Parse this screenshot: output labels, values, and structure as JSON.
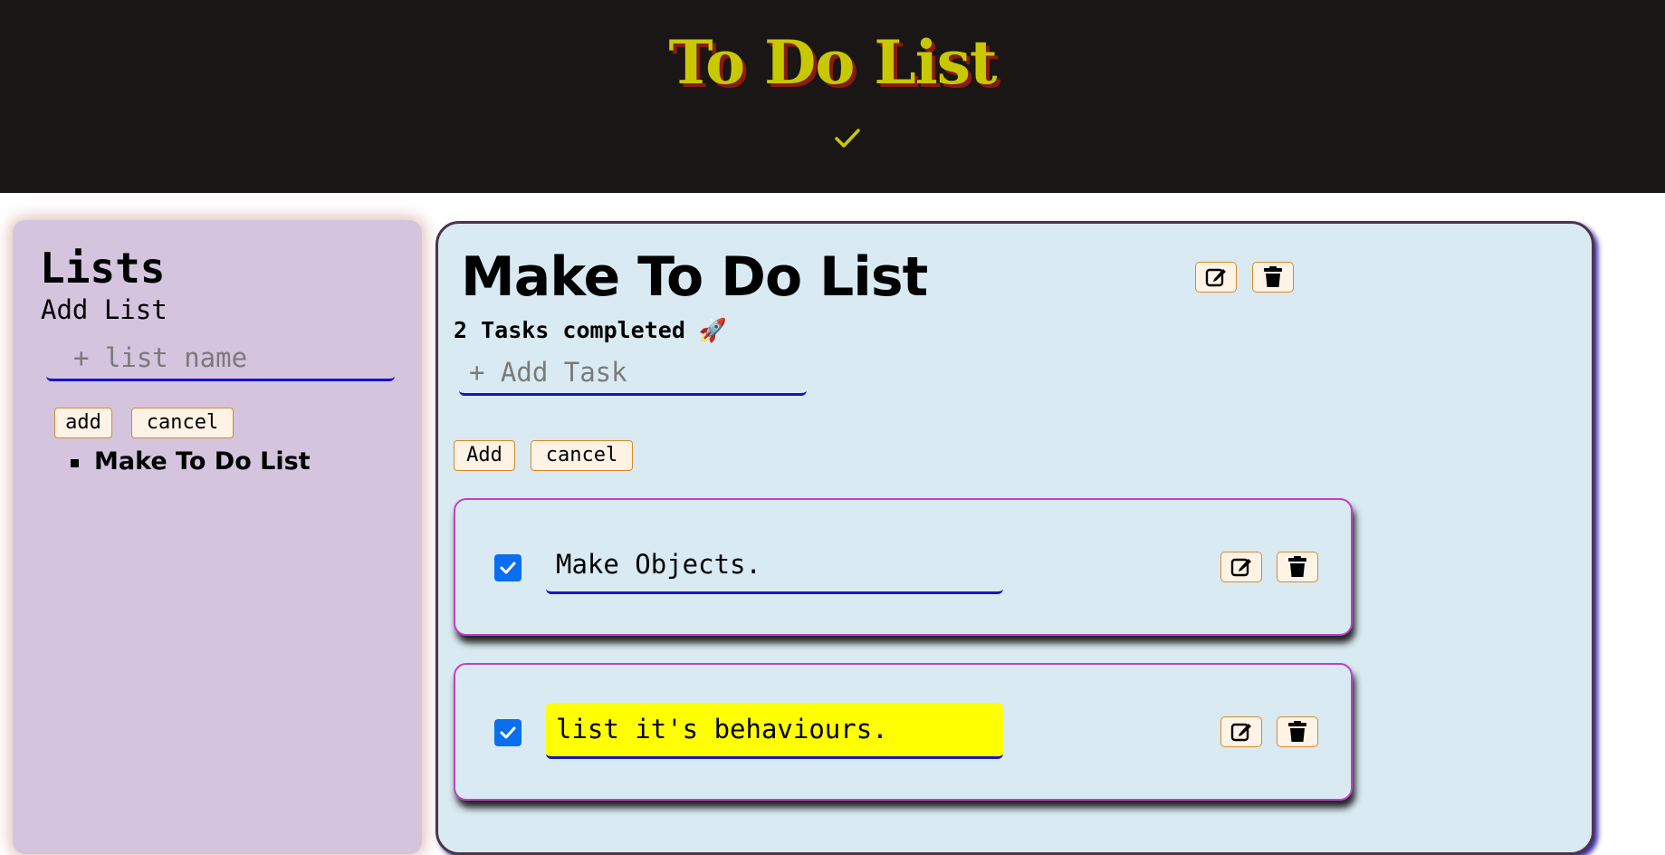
{
  "header": {
    "title": "To Do List",
    "check_icon": "checkmark-icon",
    "title_color": "#c8c800",
    "background": "#1a1616"
  },
  "sidebar": {
    "title": "Lists",
    "subtitle": "Add List",
    "input_placeholder": "+ list name",
    "input_value": "",
    "add_label": "add",
    "cancel_label": "cancel",
    "lists": [
      "Make To Do List"
    ]
  },
  "main": {
    "title": "Make To Do List",
    "edit_icon": "edit-icon",
    "delete_icon": "trash-icon",
    "completed_text": "2 Tasks completed 🚀",
    "task_placeholder": "+ Add Task",
    "task_input_value": "",
    "add_label": "Add",
    "cancel_label": "cancel",
    "tasks": [
      {
        "text": "Make Objects.",
        "checked": true,
        "highlighted": false
      },
      {
        "text": "list it's behaviours.",
        "checked": true,
        "highlighted": true
      }
    ]
  },
  "colors": {
    "accent_blue": "#1515c8",
    "checkbox_blue": "#0a6ef0",
    "highlight_yellow": "#ffff00",
    "button_border": "#d88a2a",
    "sidebar_bg": "#d4c4de",
    "main_bg": "#d9eaf2"
  }
}
